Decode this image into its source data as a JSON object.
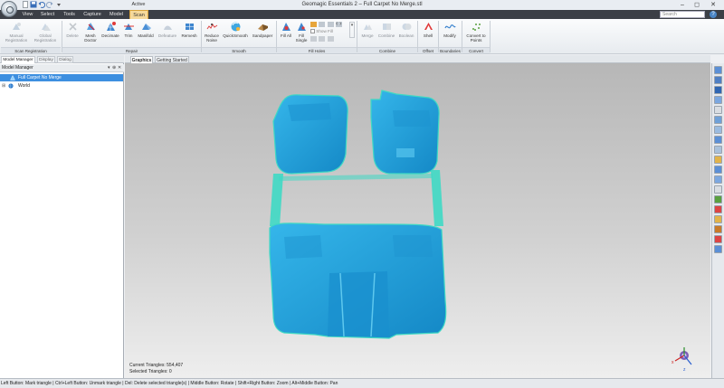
{
  "window": {
    "title": "Geomagic Essentials 2 – Full Carpet No Merge.stl",
    "context_tab_header": "Active"
  },
  "menu": {
    "tabs": [
      "View",
      "Select",
      "Tools",
      "Capture",
      "Model",
      "Scan"
    ],
    "active_tab": "Scan",
    "search_placeholder": "Search"
  },
  "ribbon": {
    "scan_registration": {
      "label": "Scan Registration",
      "buttons": [
        "Manual Registration",
        "Global Registration"
      ]
    },
    "repair": {
      "label": "Repair",
      "buttons": [
        "Delete",
        "Mesh Doctor",
        "Decimate",
        "Trim",
        "Manifold",
        "Defeature",
        "Remesh"
      ]
    },
    "smooth": {
      "label": "Smooth",
      "buttons": [
        "Reduce Noise",
        "QuickSmooth",
        "Sandpaper"
      ]
    },
    "fill_holes": {
      "label": "Fill Holes",
      "buttons": [
        "Fill All",
        "Fill Single"
      ],
      "options": [
        "Show Fill"
      ]
    },
    "combine": {
      "label": "Combine",
      "buttons": [
        "Merge",
        "Combine",
        "Boolean"
      ]
    },
    "offset": {
      "label": "Offset",
      "buttons": [
        "Shell"
      ]
    },
    "boundaries": {
      "label": "Boundaries",
      "buttons": [
        "Modify"
      ]
    },
    "convert": {
      "label": "Convert",
      "buttons": [
        "Convert to Points"
      ]
    }
  },
  "left_panel": {
    "tabs": [
      "Model Manager",
      "Display",
      "Dialog"
    ],
    "active_tab": "Model Manager",
    "header": "Model Manager",
    "tree": [
      {
        "label": "Full Carpet No Merge",
        "selected": true
      },
      {
        "label": "World",
        "selected": false
      }
    ]
  },
  "graphics": {
    "tabs": [
      "Graphics",
      "Getting Started"
    ],
    "active_tab": "Graphics",
    "current_triangles": "Current Triangles: 554,407",
    "selected_triangles": "Selected Triangles: 0",
    "mesh_color": "#1a9ed6",
    "mesh_edge_color": "#3fd9c4",
    "background_top": "#b7b7b7",
    "background_bottom": "#eeeeee"
  },
  "status_bar": {
    "text": "Left Button: Mark triangle | Ctrl+Left Button: Unmark triangle | Del: Delete selected triangle(s) | Middle Button: Rotate | Shift+Right Button: Zoom | Alt+Middle Button: Pan"
  },
  "colors": {
    "accent": "#f6d99b",
    "selection": "#3d8fe0",
    "tab_bar": "#3b3f46"
  }
}
